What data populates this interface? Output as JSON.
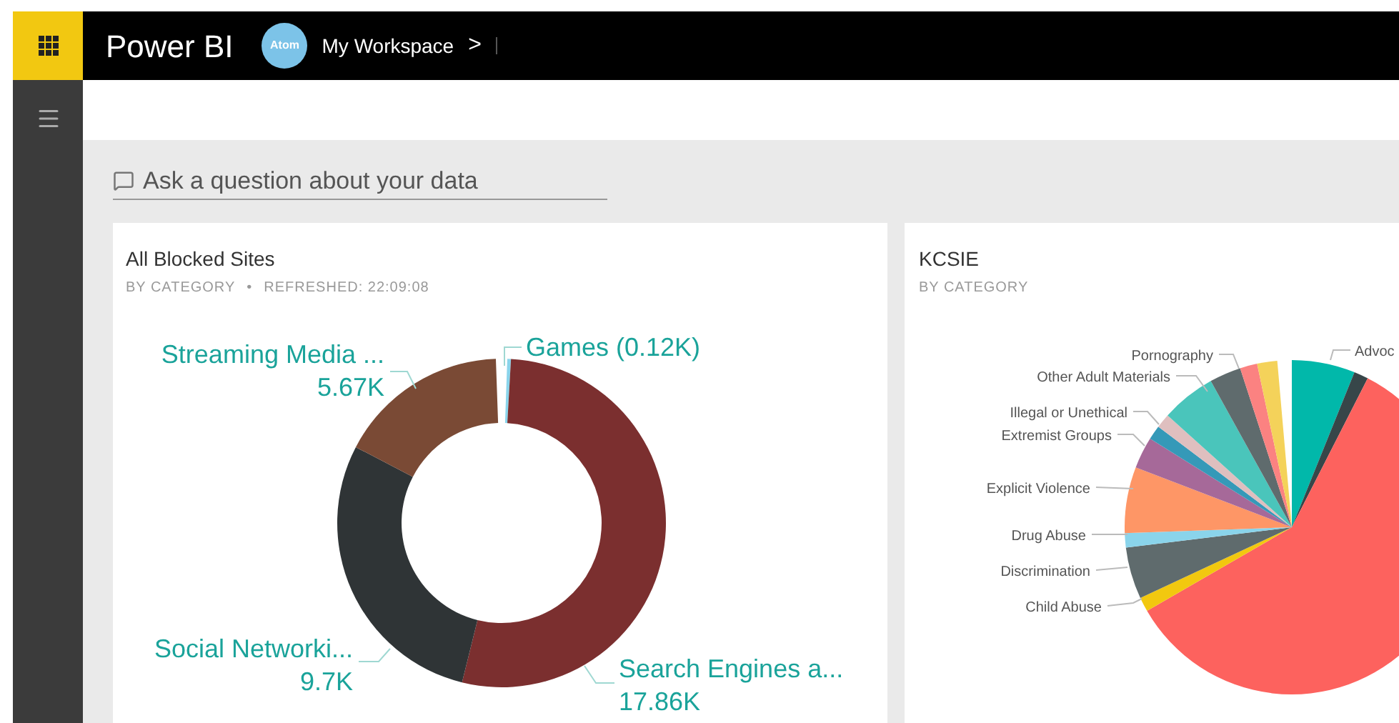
{
  "app": {
    "name": "Power BI"
  },
  "workspace": {
    "avatar": "Atom",
    "name": "My Workspace",
    "chevron": ">"
  },
  "qna": {
    "placeholder": "Ask a question about your data"
  },
  "tiles": [
    {
      "title": "All Blocked Sites",
      "subtitle": "BY CATEGORY",
      "separator": "•",
      "refreshed": "REFRESHED: 22:09:08",
      "chart_data": {
        "type": "donut",
        "categories": [
          "Games",
          "Search Engines a...",
          "Social Networki...",
          "Streaming Media ..."
        ],
        "values": [
          0.12,
          17.86,
          9.7,
          5.67
        ],
        "value_labels": [
          "(0.12K)",
          "17.86K",
          "9.7K",
          "5.67K"
        ],
        "colors": [
          "#8ad4eb",
          "#7b2f2f",
          "#2f3436",
          "#7a4a35"
        ]
      }
    },
    {
      "title": "KCSIE",
      "subtitle": "BY CATEGORY",
      "pie_labels": [
        "Advoc",
        "Pornography",
        "Other Adult Materials",
        "Illegal or Unethical",
        "Extremist Groups",
        "Explicit Violence",
        "Drug Abuse",
        "Discrimination",
        "Child Abuse"
      ]
    }
  ]
}
